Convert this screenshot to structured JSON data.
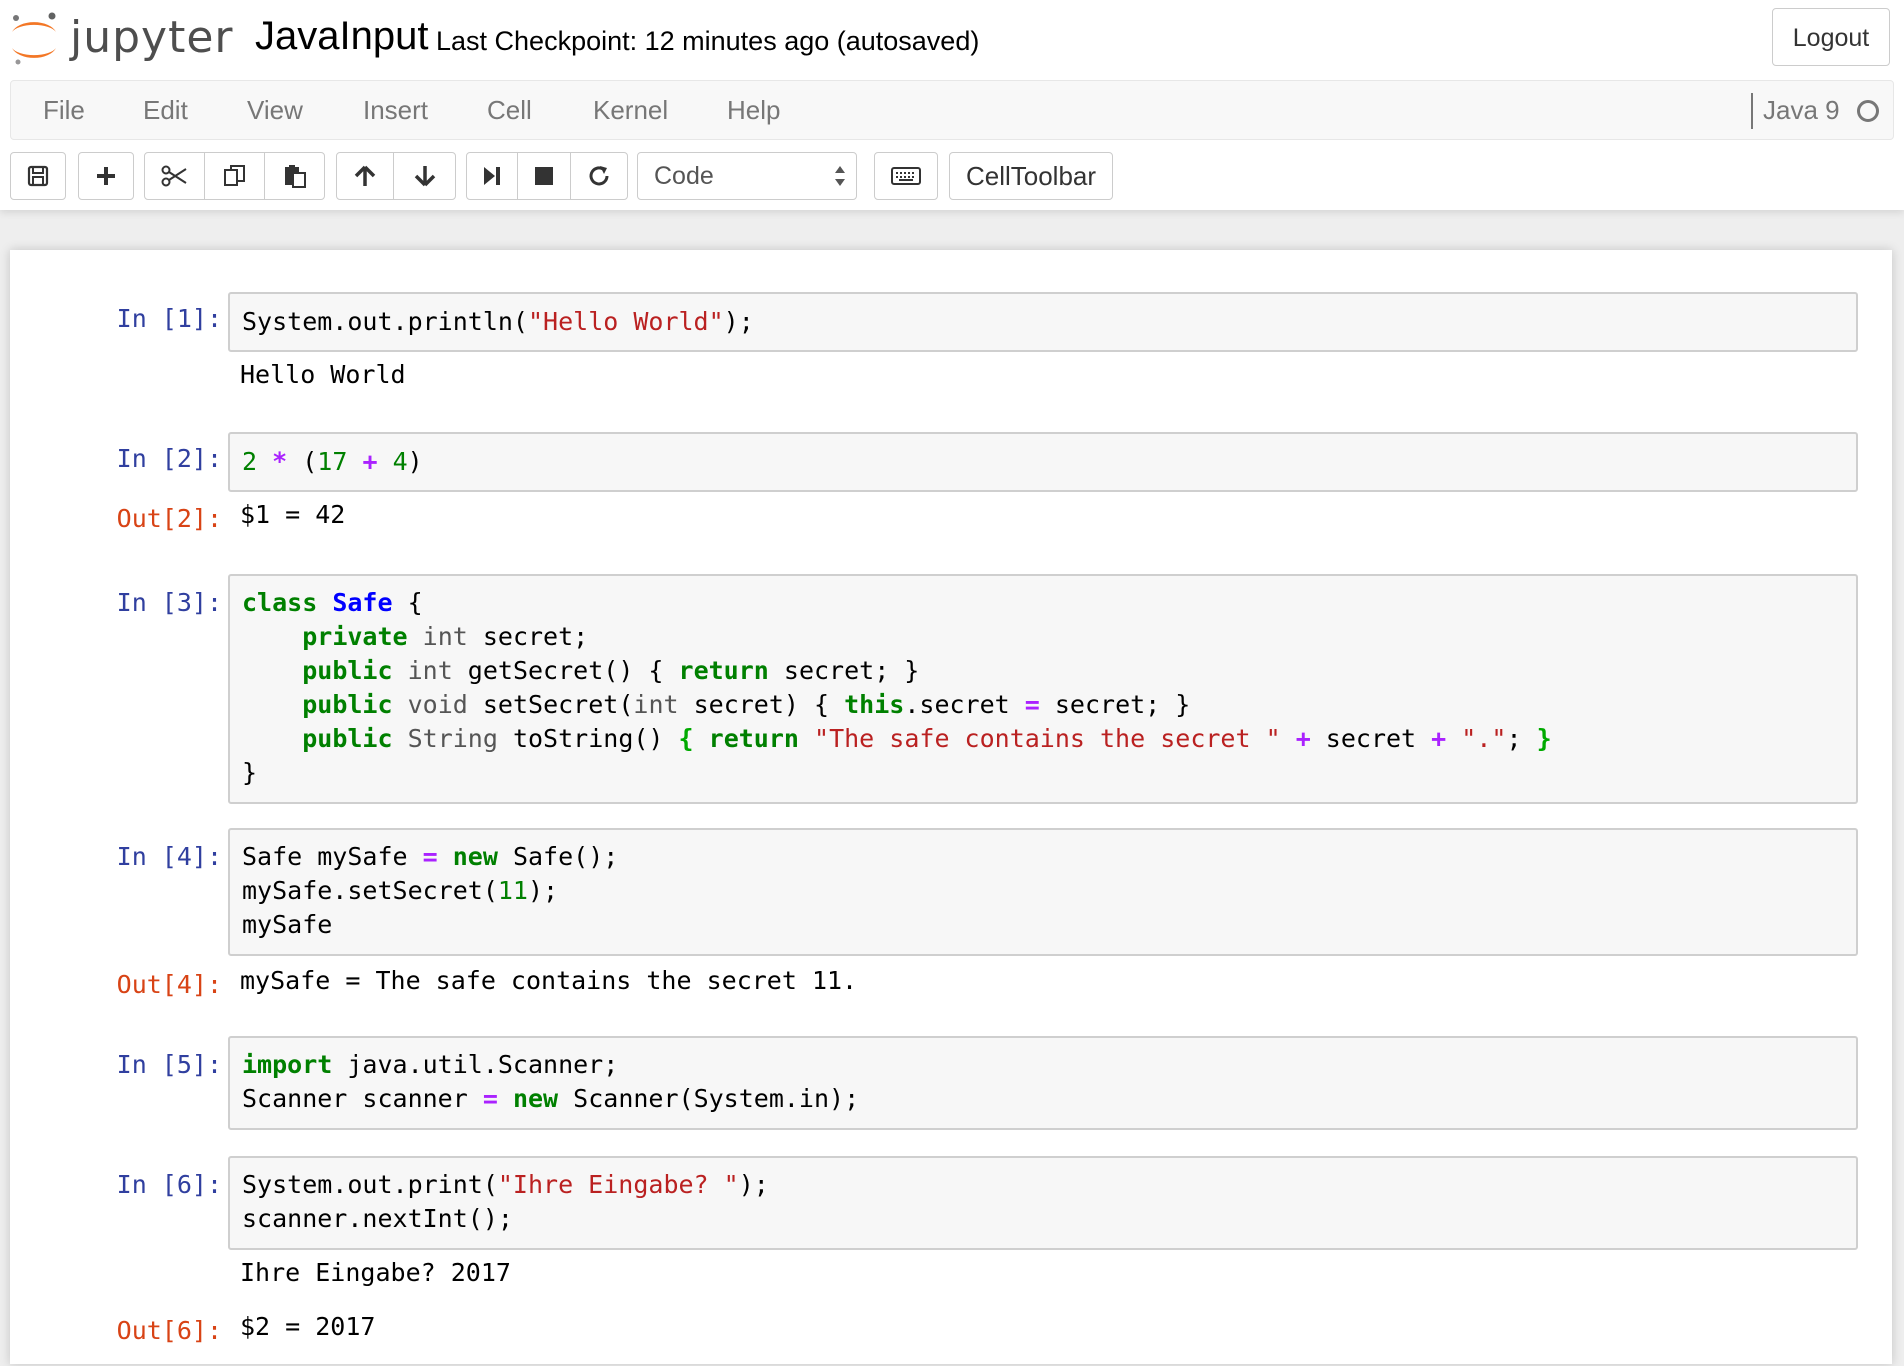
{
  "header": {
    "logo_text": "jupyter",
    "notebook_name": "JavaInput",
    "checkpoint": "Last Checkpoint: 12 minutes ago (autosaved)",
    "logout_label": "Logout"
  },
  "menubar": {
    "items": [
      "File",
      "Edit",
      "View",
      "Insert",
      "Cell",
      "Kernel",
      "Help"
    ],
    "kernel_name": "Java 9"
  },
  "toolbar": {
    "buttons": [
      {
        "icon": "save-icon"
      },
      {
        "icon": "plus-icon"
      },
      {
        "icon": "cut-icon"
      },
      {
        "icon": "copy-icon"
      },
      {
        "icon": "paste-icon"
      },
      {
        "icon": "arrow-up-icon"
      },
      {
        "icon": "arrow-down-icon"
      },
      {
        "icon": "run-icon"
      },
      {
        "icon": "stop-icon"
      },
      {
        "icon": "restart-icon"
      },
      {
        "icon": "keyboard-icon"
      }
    ],
    "cell_type": "Code",
    "celltoolbar_label": "CellToolbar"
  },
  "cells": [
    {
      "in_prompt": "In [1]:",
      "code": [
        "System.out.println(\"Hello World\");"
      ],
      "stream": "Hello World"
    },
    {
      "in_prompt": "In [2]:",
      "code": [
        "2 * (17 + 4)"
      ],
      "out_prompt": "Out[2]:",
      "result": "$1 = 42"
    },
    {
      "in_prompt": "In [3]:",
      "code": [
        "class Safe {",
        "    private int secret;",
        "    public int getSecret() { return secret; }",
        "    public void setSecret(int secret) { this.secret = secret; }",
        "    public String toString() { return \"The safe contains the secret \" + secret + \".\"; }",
        "}"
      ]
    },
    {
      "in_prompt": "In [4]:",
      "code": [
        "Safe mySafe = new Safe();",
        "mySafe.setSecret(11);",
        "mySafe"
      ],
      "out_prompt": "Out[4]:",
      "result": "mySafe = The safe contains the secret 11."
    },
    {
      "in_prompt": "In [5]:",
      "code": [
        "import java.util.Scanner;",
        "Scanner scanner = new Scanner(System.in);"
      ]
    },
    {
      "in_prompt": "In [6]:",
      "code": [
        "System.out.print(\"Ihre Eingabe? \");",
        "scanner.nextInt();"
      ],
      "stream": "Ihre Eingabe? 2017",
      "out_prompt": "Out[6]:",
      "result": "$2 = 2017"
    }
  ]
}
